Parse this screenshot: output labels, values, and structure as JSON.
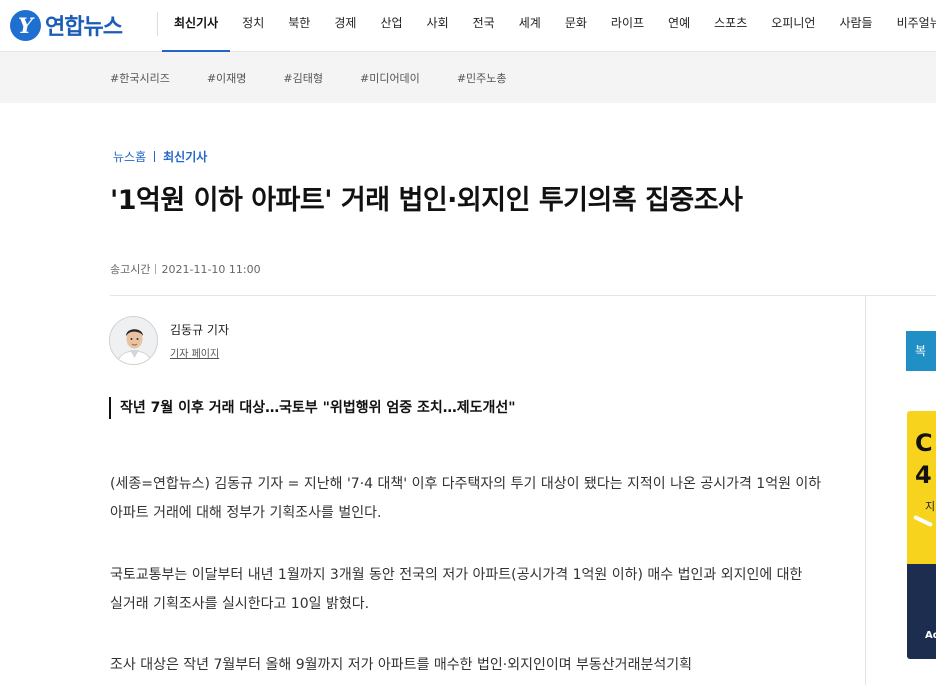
{
  "header": {
    "logo_mark": "Y",
    "logo_text": "연합뉴스",
    "menu": [
      "최신기사",
      "정치",
      "북한",
      "경제",
      "산업",
      "사회",
      "전국",
      "세계",
      "문화",
      "라이프",
      "연예",
      "스포츠",
      "오피니언",
      "사람들",
      "비주얼뉴스"
    ],
    "active_menu": "최신기사"
  },
  "tags": [
    "#한국시리즈",
    "#이재명",
    "#김태형",
    "#미디어데이",
    "#민주노총"
  ],
  "breadcrumb": {
    "home": "뉴스홈",
    "current": "최신기사"
  },
  "article": {
    "headline": "'1억원 이하 아파트' 거래 법인·외지인 투기의혹 집중조사",
    "time_label": "송고시간",
    "time_value": "2021-11-10 11:00",
    "reporter": {
      "name": "김동규 기자",
      "page_link": "기자 페이지"
    },
    "subhead": "작년 7월 이후 거래 대상…국토부 \"위법행위 엄중 조치…제도개선\"",
    "paragraphs": [
      "(세종=연합뉴스) 김동규 기자 = 지난해 '7·4 대책' 이후 다주택자의 투기 대상이 됐다는 지적이 나온 공시가격 1억원 이하 아파트 거래에 대해 정부가 기획조사를 벌인다.",
      "국토교통부는 이달부터 내년 1월까지 3개월 동안 전국의 저가 아파트(공시가격 1억원 이하) 매수 법인과 외지인에 대한 실거래 기획조사를 실시한다고 10일 밝혔다.",
      "조사 대상은 작년 7월부터 올해 9월까지 저가 아파트를 매수한 법인·외지인이며 부동산거래분석기획"
    ]
  },
  "sidebar": {
    "button_label": "복",
    "ad": {
      "line1": "C",
      "line2": "4",
      "line3": "지",
      "bottom": "Ad"
    }
  },
  "colors": {
    "brand_blue": "#2466c7",
    "logo_blue": "#1f6fd1",
    "sidebar_button": "#1f8fc6",
    "ad_yellow": "#f7d31d",
    "ad_navy": "#1d2d4f"
  },
  "icons": {
    "logo": "yonhap-logo-icon",
    "avatar": "reporter-avatar"
  }
}
